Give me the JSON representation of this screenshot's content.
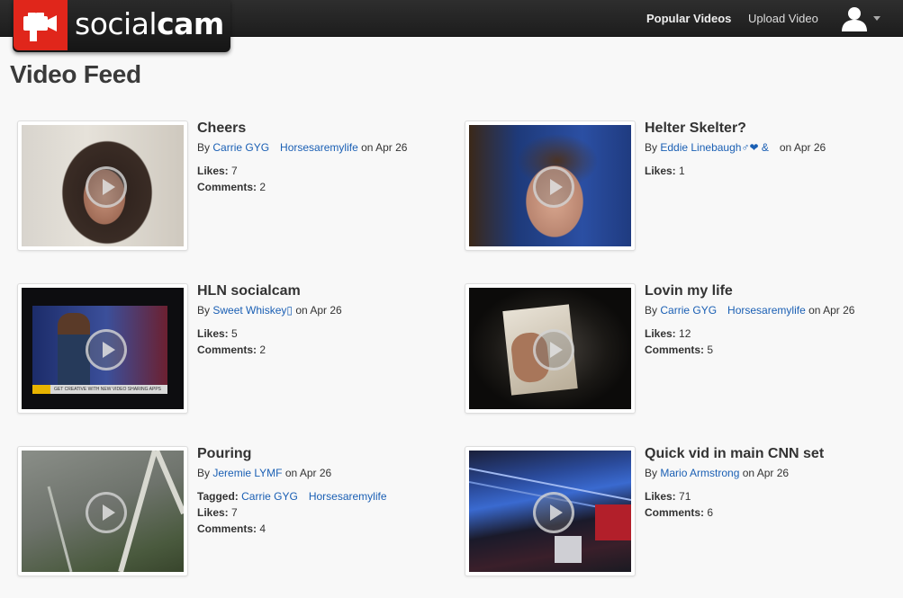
{
  "brand": {
    "name_light": "social",
    "name_bold": "cam",
    "color": "#e0261b"
  },
  "nav": {
    "popular": "Popular Videos",
    "upload": "Upload Video",
    "user_icon": "user-icon",
    "menu_icon": "caret-down-icon"
  },
  "page": {
    "title": "Video Feed"
  },
  "videos": [
    {
      "title": "Cheers",
      "by_label": "By",
      "authors": [
        "Carrie GYG",
        "Horsesaremylife"
      ],
      "on": "on Apr 26",
      "likes_label": "Likes:",
      "likes": "7",
      "comments_label": "Comments:",
      "comments": "2"
    },
    {
      "title": "Helter Skelter?",
      "by_label": "By",
      "authors": [
        "Eddie Linebaugh♂❤ &"
      ],
      "on": "on Apr 26",
      "likes_label": "Likes:",
      "likes": "1"
    },
    {
      "title": "HLN socialcam",
      "by_label": "By",
      "authors": [
        "Sweet Whiskey▯"
      ],
      "on": "on Apr 26",
      "likes_label": "Likes:",
      "likes": "5",
      "comments_label": "Comments:",
      "comments": "2",
      "ticker": "GET CREATIVE WITH NEW VIDEO SHARING APPS"
    },
    {
      "title": "Lovin my life",
      "by_label": "By",
      "authors": [
        "Carrie GYG",
        "Horsesaremylife"
      ],
      "on": "on Apr 26",
      "likes_label": "Likes:",
      "likes": "12",
      "comments_label": "Comments:",
      "comments": "5"
    },
    {
      "title": "Pouring",
      "by_label": "By",
      "authors": [
        "Jeremie LYMF"
      ],
      "on": "on Apr 26",
      "tagged_label": "Tagged:",
      "tagged": [
        "Carrie GYG",
        "Horsesaremylife"
      ],
      "likes_label": "Likes:",
      "likes": "7",
      "comments_label": "Comments:",
      "comments": "4"
    },
    {
      "title": "Quick vid in main CNN set",
      "by_label": "By",
      "authors": [
        "Mario Armstrong"
      ],
      "on": "on Apr 26",
      "likes_label": "Likes:",
      "likes": "71",
      "comments_label": "Comments:",
      "comments": "6"
    }
  ]
}
